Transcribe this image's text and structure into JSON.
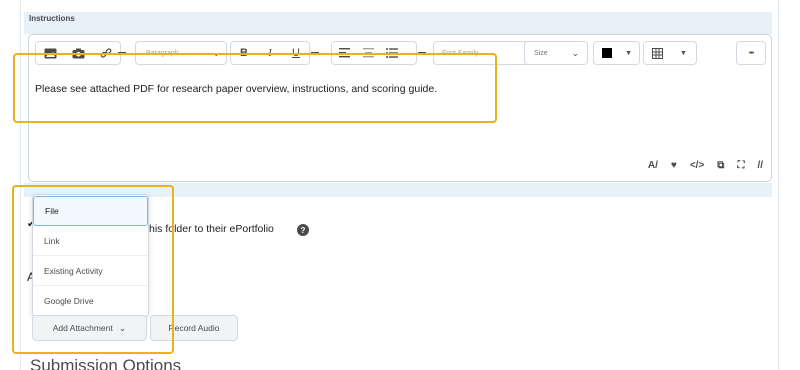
{
  "instructions": {
    "label": "Instructions"
  },
  "editor": {
    "toolbar": {
      "paragraph_placeholder": "Paragraph",
      "font_family_placeholder": "Font Family",
      "size_placeholder": "Size",
      "bold": "B",
      "italic": "I",
      "underline": "U",
      "more": "•••"
    },
    "content": "Please see attached PDF for research paper overview, instructions, and scoring guide.",
    "colors": {
      "font_color": "#000000",
      "highlight": "#e8b31a"
    }
  },
  "eportfolio": {
    "text_fragment": "his folder to their ePortfolio",
    "help_icon": "question-circle-icon"
  },
  "attachment_menu": {
    "items": [
      "File",
      "Link",
      "Existing Activity",
      "Google Drive"
    ],
    "selected": "File"
  },
  "buttons": {
    "add_attachment": "Add Attachment",
    "record_audio": "Record Audio"
  },
  "submission": {
    "heading": "Submission Options"
  }
}
